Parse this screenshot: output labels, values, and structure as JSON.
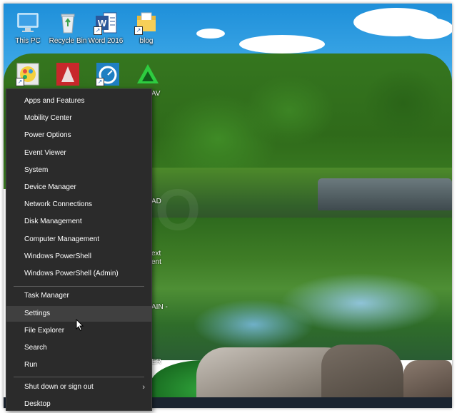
{
  "desktop": {
    "icons_row1": [
      {
        "label": "This PC",
        "icon": "this-pc-icon"
      },
      {
        "label": "Recycle Bin",
        "icon": "recycle-bin-icon"
      },
      {
        "label": "Word 2016",
        "icon": "word-icon"
      },
      {
        "label": "blog",
        "icon": "folder-icon"
      }
    ],
    "icons_row2": [
      {
        "label": "",
        "icon": "paint-app-icon"
      },
      {
        "label": "",
        "icon": "autocad-icon"
      },
      {
        "label": "",
        "icon": "speedometer-app-icon"
      },
      {
        "label": "",
        "icon": "green-triangle-app-icon"
      }
    ],
    "peek_labels": [
      "AV",
      "AD",
      "ext",
      "ent",
      "AIN -",
      "ER"
    ],
    "watermark": "DEMO"
  },
  "menu": {
    "group1": [
      "Apps and Features",
      "Mobility Center",
      "Power Options",
      "Event Viewer",
      "System",
      "Device Manager",
      "Network Connections",
      "Disk Management",
      "Computer Management",
      "Windows PowerShell",
      "Windows PowerShell (Admin)"
    ],
    "group2": [
      "Task Manager",
      "Settings",
      "File Explorer",
      "Search",
      "Run"
    ],
    "group3": [
      "Shut down or sign out",
      "Desktop"
    ],
    "highlighted_item": "Settings",
    "submenu_arrow": "›"
  },
  "colors": {
    "menu_bg": "#2b2b2b",
    "menu_highlight": "#404040",
    "menu_text": "#ffffff"
  }
}
